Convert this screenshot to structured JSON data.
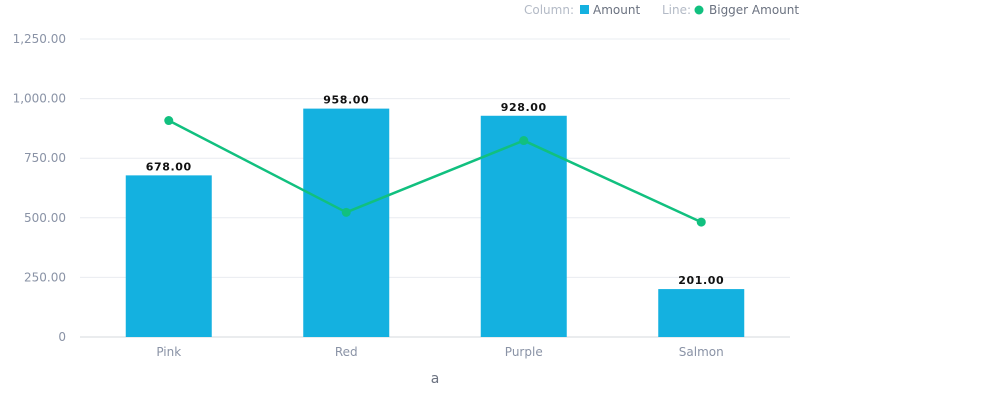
{
  "chart_data": {
    "type": "bar",
    "categories": [
      "Pink",
      "Red",
      "Purple",
      "Salmon"
    ],
    "series": [
      {
        "name": "Amount",
        "kind": "column",
        "values": [
          678,
          958,
          928,
          201
        ],
        "color": "#14b1e0"
      },
      {
        "name": "Bigger Amount",
        "kind": "line",
        "values": [
          908,
          523,
          824,
          482
        ],
        "color": "#11c07f"
      }
    ],
    "data_labels": [
      "678.00",
      "958.00",
      "928.00",
      "201.00"
    ],
    "y_ticks": [
      {
        "value": 0,
        "label": "0"
      },
      {
        "value": 250,
        "label": "250.00"
      },
      {
        "value": 500,
        "label": "500.00"
      },
      {
        "value": 750,
        "label": "750.00"
      },
      {
        "value": 1000,
        "label": "1,000.00"
      },
      {
        "value": 1250,
        "label": "1,250.00"
      }
    ],
    "xlabel": "a",
    "ylabel": "",
    "ylim": [
      0,
      1250
    ],
    "grid": true,
    "legend": {
      "placement": "top-right",
      "column_prefix": "Column:",
      "line_prefix": "Line:"
    }
  }
}
